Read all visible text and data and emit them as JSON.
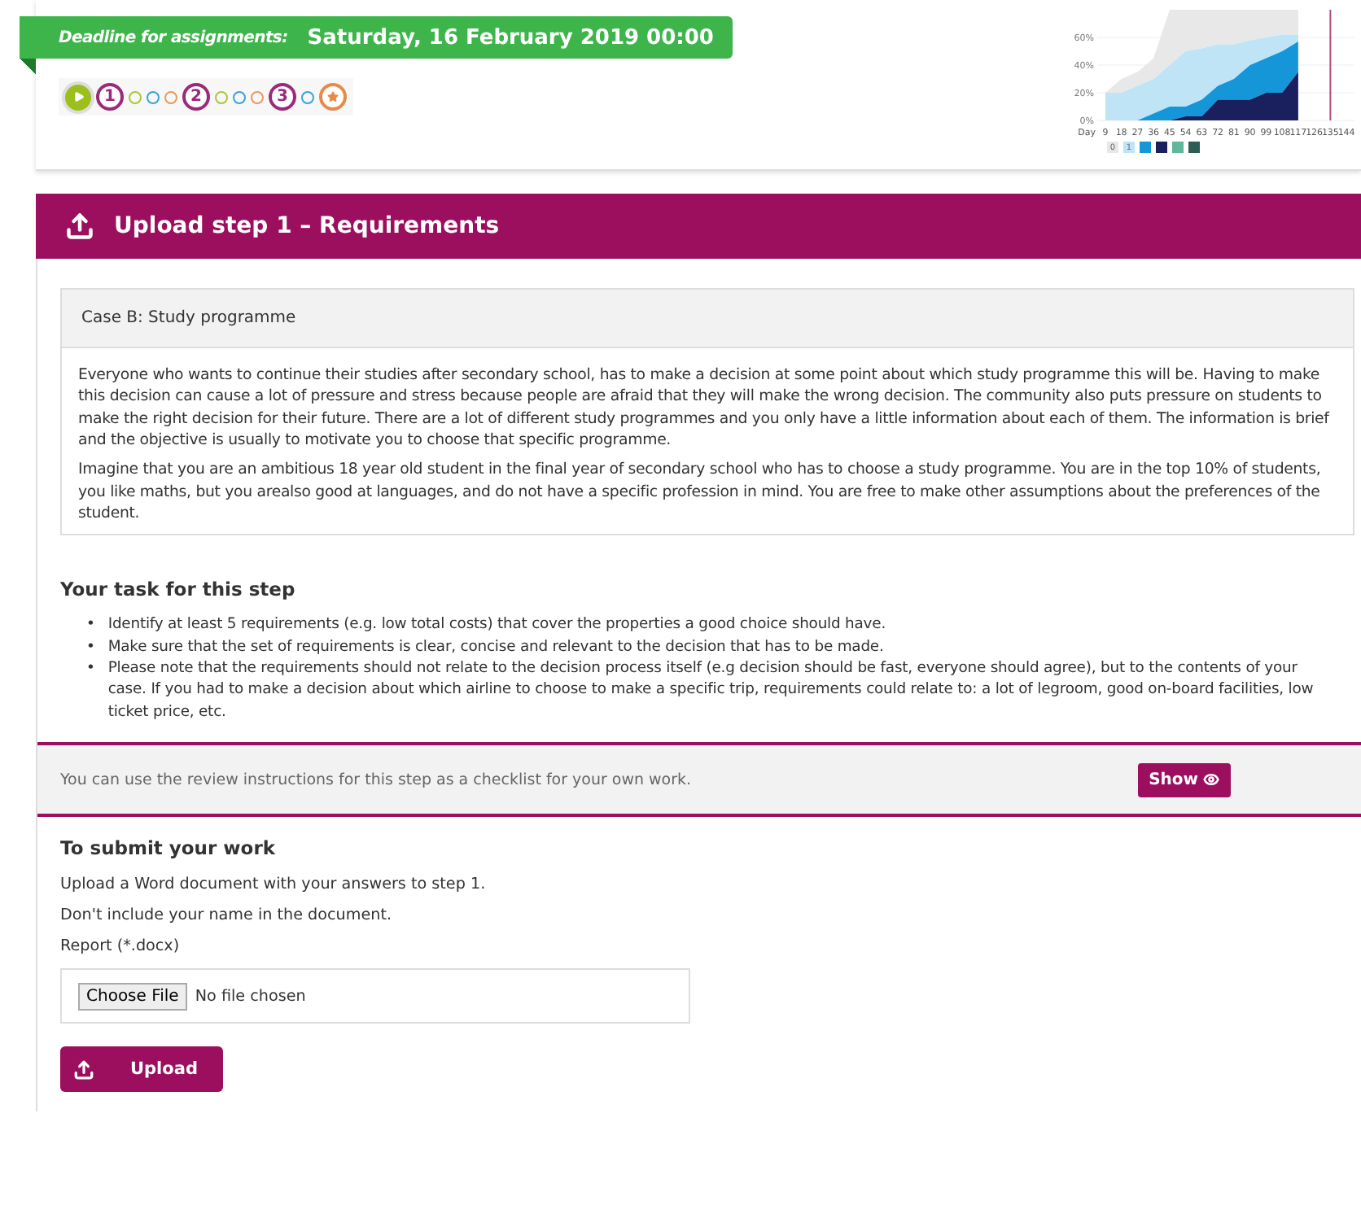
{
  "deadline": {
    "label": "Deadline for assignments:",
    "date": "Saturday, 16 February 2019 00:00"
  },
  "progress": [
    {
      "kind": "start",
      "color": "#9cbf1e",
      "selected": true
    },
    {
      "kind": "step",
      "text": "1",
      "color": "#9c2a7a",
      "selected": false
    },
    {
      "kind": "dot",
      "color": "#a9c83a",
      "selected": false
    },
    {
      "kind": "dot",
      "color": "#3aa3d8",
      "selected": false
    },
    {
      "kind": "dot",
      "color": "#e89a5a",
      "selected": false
    },
    {
      "kind": "step",
      "text": "2",
      "color": "#9c2a7a",
      "selected": false
    },
    {
      "kind": "dot",
      "color": "#a9c83a",
      "selected": false
    },
    {
      "kind": "dot",
      "color": "#3aa3d8",
      "selected": false
    },
    {
      "kind": "dot",
      "color": "#e89a5a",
      "selected": false
    },
    {
      "kind": "step",
      "text": "3",
      "color": "#9c2a7a",
      "selected": false
    },
    {
      "kind": "dot",
      "color": "#3aa3d8",
      "selected": false
    },
    {
      "kind": "finish",
      "color": "#e8894a",
      "selected": false
    }
  ],
  "chart_data": {
    "type": "area",
    "stacked": true,
    "xlabel": "Day",
    "categories": [
      "9",
      "18",
      "27",
      "36",
      "45",
      "54",
      "63",
      "72",
      "81",
      "90",
      "99",
      "108",
      "117",
      "126",
      "135",
      "144"
    ],
    "ylim": [
      0,
      80
    ],
    "yticks": [
      {
        "value": 0,
        "label": "0%"
      },
      {
        "value": 20,
        "label": "20%"
      },
      {
        "value": 40,
        "label": "40%"
      },
      {
        "value": 60,
        "label": "60%"
      }
    ],
    "grid": true,
    "ref_lines": [
      {
        "axis": "x",
        "value": "135",
        "color": "#b04a8a"
      }
    ],
    "series": [
      {
        "color": "#1a1f5e",
        "values": [
          0,
          0,
          0,
          0,
          0,
          3,
          3,
          15,
          15,
          15,
          20,
          20,
          35,
          null,
          null,
          null
        ]
      },
      {
        "color": "#1596d9",
        "values": [
          0,
          0,
          0,
          5,
          10,
          7,
          12,
          10,
          15,
          25,
          25,
          30,
          22,
          null,
          null,
          null
        ]
      },
      {
        "color": "#bfe4f6",
        "values": [
          20,
          20,
          25,
          25,
          30,
          40,
          37,
          30,
          25,
          18,
          15,
          12,
          5,
          null,
          null,
          null
        ]
      },
      {
        "color": "#e8e8e8",
        "values": [
          0,
          10,
          10,
          15,
          40,
          30,
          28,
          25,
          25,
          22,
          20,
          18,
          18,
          null,
          null,
          null
        ]
      }
    ]
  },
  "chart_legend": [
    {
      "color": "#e8e8e8",
      "text": "0"
    },
    {
      "color": "#bfe4f6",
      "text": "1"
    },
    {
      "color": "#1596d9"
    },
    {
      "color": "#1a1f5e"
    },
    {
      "color": "#5fb89a"
    },
    {
      "color": "#2c5e55"
    }
  ],
  "step_header": {
    "title": "Upload step 1 – Requirements"
  },
  "case": {
    "title": "Case B: Study programme",
    "paragraphs": [
      "Everyone who wants to continue their studies after secondary school, has to make a decision at some point about which study programme this will be. Having to make this decision can cause a lot of pressure and stress because people are afraid that they will make the wrong decision. The community also puts pressure on students to make the right decision for their future. There are a lot of different study programmes and you only have a little information about each of them. The information is brief and the objective is usually to motivate you to choose that specific programme.",
      "Imagine that you are an ambitious 18 year old student in the final year of secondary school who has to choose a study programme. You are in the top 10% of students, you like maths, but you arealso good at languages, and do not have a specific profession in mind. You are free to make other assumptions about the preferences of the student."
    ]
  },
  "task": {
    "heading": "Your task for this step",
    "marker": "•",
    "items": [
      "Identify at least 5 requirements (e.g. low total costs) that cover the properties a good choice should have.",
      "Make sure that the set of requirements is clear, concise and relevant to the decision that has to be made.",
      "Please note that the requirements should not relate to the decision process itself (e.g decision should be fast, everyone should agree), but to the contents of your case. If you had to make a decision about which airline to choose to make a specific trip, requirements could relate to: a lot of legroom, good on-board facilities, low ticket price, etc."
    ]
  },
  "review": {
    "text": "You can use the review instructions for this step as a checklist for your own work.",
    "button": "Show"
  },
  "submit": {
    "heading": "To submit your work",
    "lines": [
      "Upload a Word document with your answers to step 1.",
      "Don't include your name in the document."
    ],
    "field_label": "Report (*.docx)",
    "choose_button": "Choose File",
    "file_status": "No file chosen",
    "upload_button": "Upload"
  }
}
